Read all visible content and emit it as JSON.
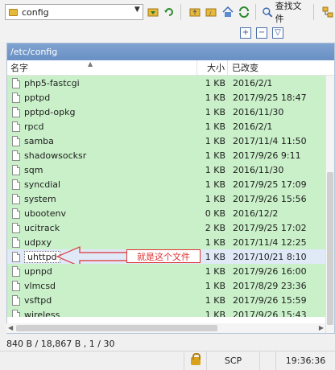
{
  "toolbar": {
    "path_combo": "config",
    "find_files_label": "查找文件"
  },
  "path_bar": "/etc/config",
  "columns": {
    "name": "名字",
    "size": "大小",
    "modified": "已改变"
  },
  "files": [
    {
      "name": "php5-fastcgi",
      "size": "1 KB",
      "modified": "2016/2/1"
    },
    {
      "name": "pptpd",
      "size": "1 KB",
      "modified": "2017/9/25 18:47"
    },
    {
      "name": "pptpd-opkg",
      "size": "1 KB",
      "modified": "2016/11/30"
    },
    {
      "name": "rpcd",
      "size": "1 KB",
      "modified": "2016/2/1"
    },
    {
      "name": "samba",
      "size": "1 KB",
      "modified": "2017/11/4 11:50"
    },
    {
      "name": "shadowsocksr",
      "size": "1 KB",
      "modified": "2017/9/26 9:11"
    },
    {
      "name": "sqm",
      "size": "1 KB",
      "modified": "2016/11/30"
    },
    {
      "name": "syncdial",
      "size": "1 KB",
      "modified": "2017/9/25 17:09"
    },
    {
      "name": "system",
      "size": "1 KB",
      "modified": "2017/9/26 15:56"
    },
    {
      "name": "ubootenv",
      "size": "0 KB",
      "modified": "2016/12/2"
    },
    {
      "name": "ucitrack",
      "size": "2 KB",
      "modified": "2017/9/25 17:02"
    },
    {
      "name": "udpxy",
      "size": "1 KB",
      "modified": "2017/11/4 12:25"
    },
    {
      "name": "uhttpd",
      "size": "1 KB",
      "modified": "2017/10/21 8:10"
    },
    {
      "name": "upnpd",
      "size": "1 KB",
      "modified": "2017/9/26 16:00"
    },
    {
      "name": "vlmcsd",
      "size": "1 KB",
      "modified": "2017/8/29 23:36"
    },
    {
      "name": "vsftpd",
      "size": "1 KB",
      "modified": "2017/9/26 15:59"
    },
    {
      "name": "wireless",
      "size": "1 KB",
      "modified": "2017/9/26 15:43"
    }
  ],
  "annotation": "就是这个文件",
  "status": {
    "summary": "840 B / 18,867 B , 1 / 30",
    "protocol": "SCP",
    "time": "19:36:36"
  },
  "colors": {
    "row_green": "#c9f0c9",
    "path_bar": "#7fa3d1",
    "annotation_red": "#dd3333"
  }
}
